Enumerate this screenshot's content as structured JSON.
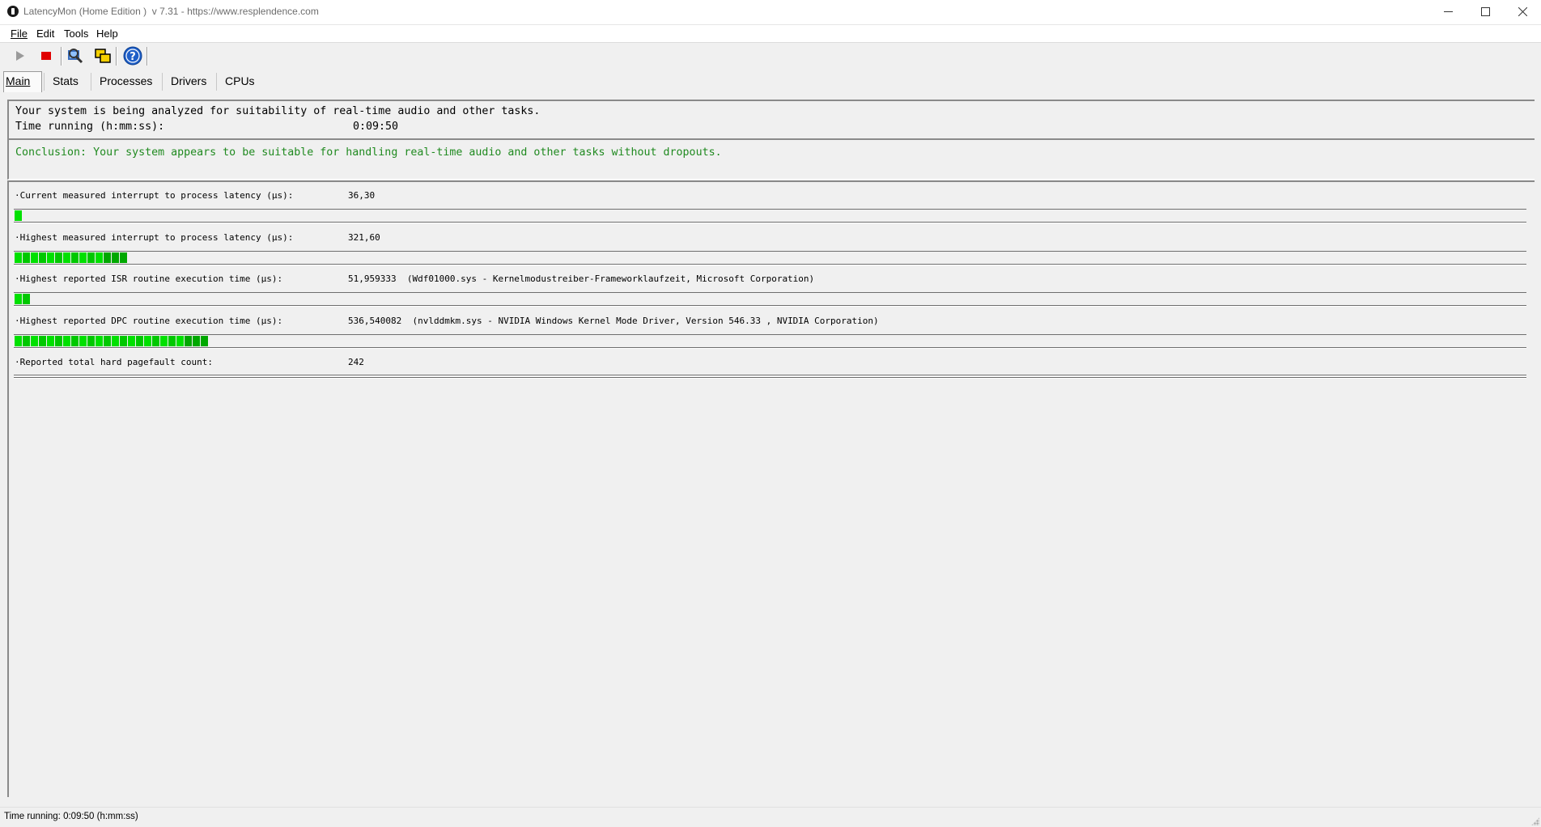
{
  "window": {
    "app_name": "LatencyMon",
    "title_rest": " (Home Edition )  v 7.31 - https://www.resplendence.com"
  },
  "menu": [
    {
      "label": "File"
    },
    {
      "label": "Edit"
    },
    {
      "label": "Tools"
    },
    {
      "label": "Help"
    }
  ],
  "toolbar": {
    "icons": [
      "play-icon",
      "stop-icon",
      "analyze-icon",
      "windows-icon",
      "help-icon"
    ]
  },
  "tabs": [
    {
      "label": "Main",
      "active": true
    },
    {
      "label": "Stats"
    },
    {
      "label": "Processes"
    },
    {
      "label": "Drivers"
    },
    {
      "label": "CPUs"
    }
  ],
  "summary": {
    "line1": "Your system is being analyzed for suitability of real-time audio and other tasks.",
    "time_label": "Time running (h:mm:ss):",
    "time_value": "0:09:50"
  },
  "conclusion": {
    "text": "Conclusion: Your system appears to be suitable for handling real-time audio and other tasks without dropouts.",
    "color": "#208a20"
  },
  "metrics": [
    {
      "label": "·Current measured interrupt to process latency (µs):",
      "value": "36,30",
      "detail": "",
      "bar_segments": 1
    },
    {
      "label": "·Highest measured interrupt to process latency (µs):",
      "value": "321,60",
      "detail": "",
      "bar_segments": 14
    },
    {
      "label": "·Highest reported ISR routine execution time (µs):",
      "value": "51,959333",
      "detail": "(Wdf01000.sys - Kernelmodustreiber-Frameworklaufzeit, Microsoft Corporation)",
      "bar_segments": 2
    },
    {
      "label": "·Highest reported DPC routine execution time (µs):",
      "value": "536,540082",
      "detail": "(nvlddmkm.sys - NVIDIA Windows Kernel Mode Driver, Version 546.33 , NVIDIA Corporation)",
      "bar_segments": 24
    },
    {
      "label": "·Reported total hard pagefault count:",
      "value": "242",
      "detail": "",
      "bar_segments": 0
    }
  ],
  "statusbar": {
    "text": "Time running: 0:09:50  (h:mm:ss)"
  }
}
